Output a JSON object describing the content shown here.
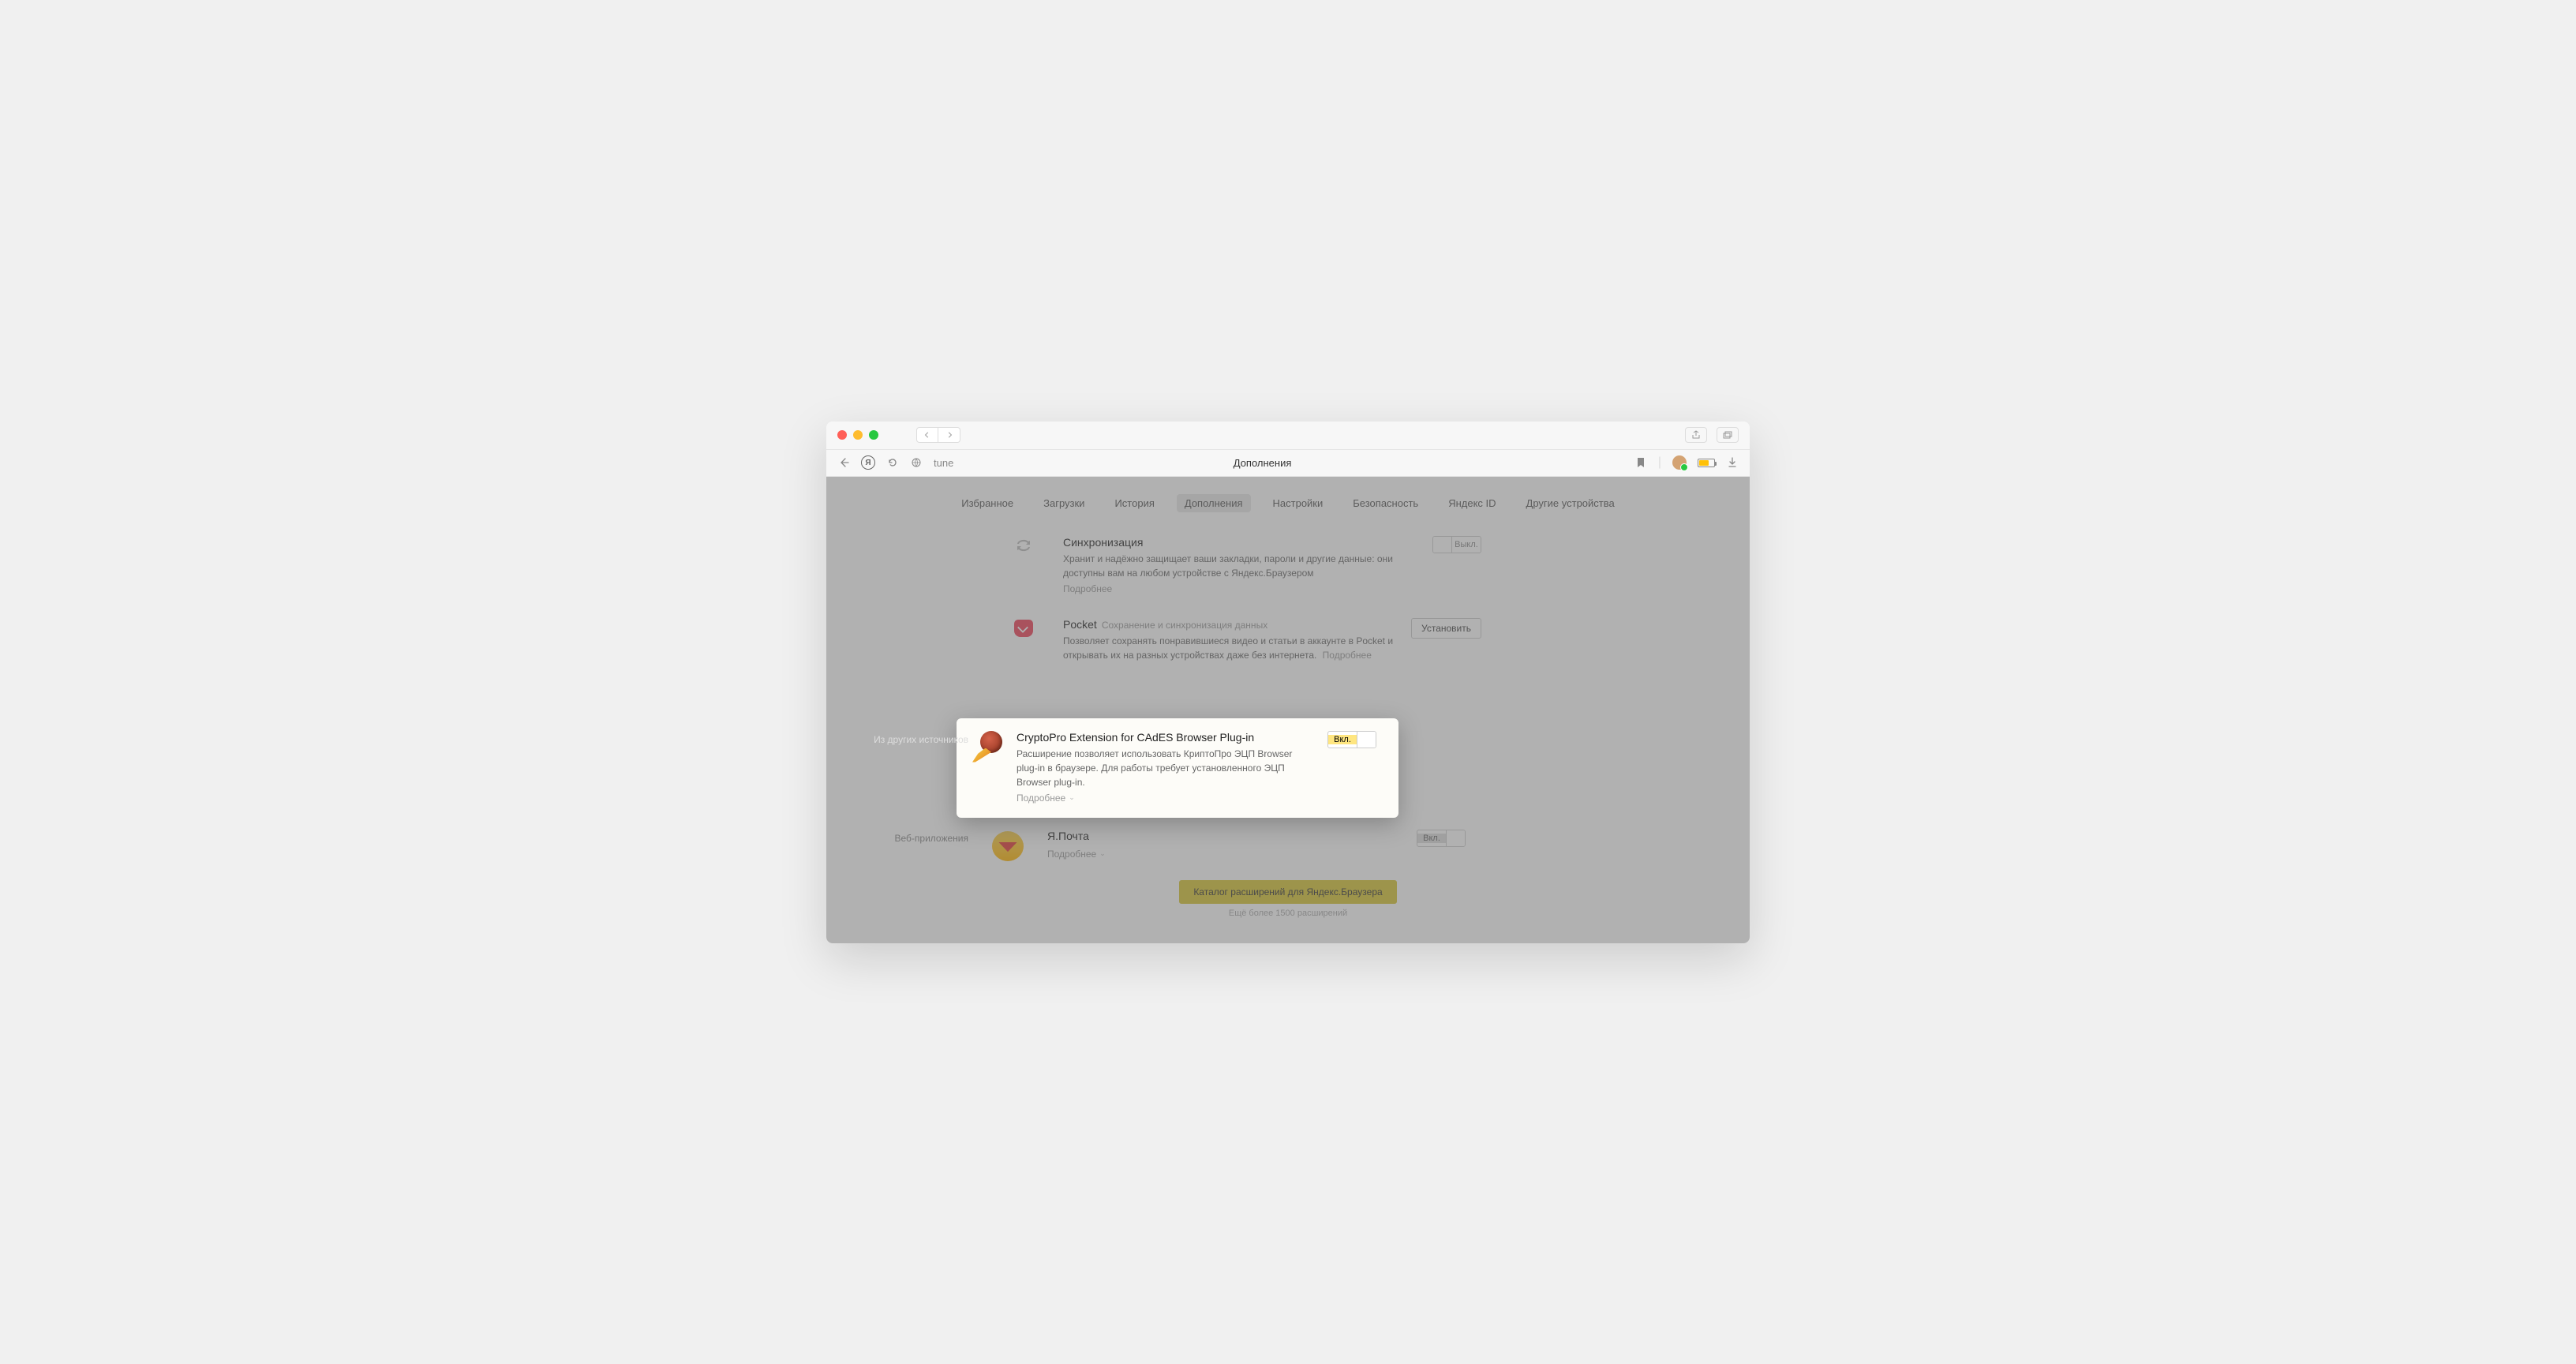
{
  "addressbar": {
    "url_text": "tune",
    "title": "Дополнения"
  },
  "tabs": {
    "items": [
      {
        "label": "Избранное"
      },
      {
        "label": "Загрузки"
      },
      {
        "label": "История"
      },
      {
        "label": "Дополнения"
      },
      {
        "label": "Настройки"
      },
      {
        "label": "Безопасность"
      },
      {
        "label": "Яндекс ID"
      },
      {
        "label": "Другие устройства"
      }
    ],
    "active_index": 3
  },
  "sections": {
    "builtin": {
      "sync": {
        "title": "Синхронизация",
        "desc": "Хранит и надёжно защищает ваши закладки, пароли и другие данные: они доступны вам на любом устройстве с Яндекс.Браузером",
        "more": "Подробнее",
        "toggle_label": "Выкл."
      },
      "pocket": {
        "title": "Pocket",
        "subtitle": "Сохранение и синхронизация данных",
        "desc": "Позволяет сохранять понравившиеся видео и статьи в аккаунте в Pocket и открывать их на разных устройствах даже без интернета.",
        "more": "Подробнее",
        "install_label": "Установить"
      }
    },
    "other_sources": {
      "label": "Из других источников",
      "crypto": {
        "title": "CryptoPro Extension for CAdES Browser Plug-in",
        "desc": "Расширение позволяет использовать КриптоПро ЭЦП Browser plug-in в браузере. Для работы требует установленного ЭЦП Browser plug-in.",
        "more": "Подробнее",
        "toggle_label": "Вкл."
      }
    },
    "webapps": {
      "label": "Веб-приложения",
      "ymail": {
        "title": "Я.Почта",
        "more": "Подробнее",
        "toggle_label": "Вкл."
      }
    }
  },
  "catalog": {
    "button": "Каталог расширений для Яндекс.Браузера",
    "subtitle": "Ещё более 1500 расширений"
  }
}
